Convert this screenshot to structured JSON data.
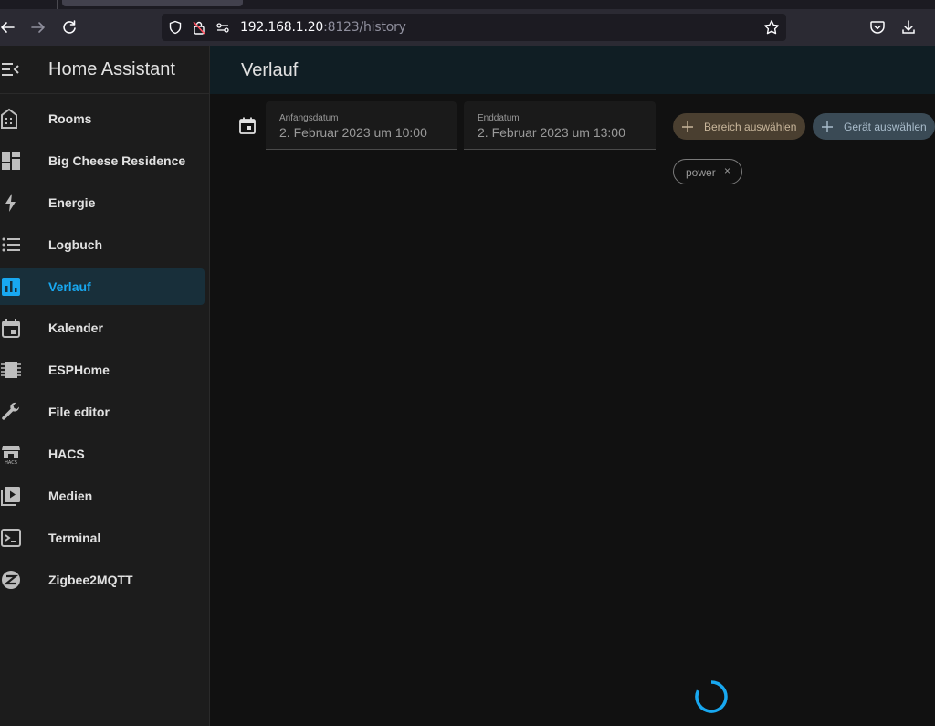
{
  "browser": {
    "url_host": "192.168.1.20",
    "url_rest": ":8123/history",
    "icons": [
      "back-icon",
      "forward-icon",
      "reload-icon",
      "shield-icon",
      "tracking-lock-icon",
      "permissions-icon",
      "bookmark-star-icon",
      "pocket-icon",
      "download-icon"
    ]
  },
  "sidebar": {
    "title": "Home Assistant",
    "items": [
      {
        "label": "Rooms",
        "icon": "building-icon"
      },
      {
        "label": "Big Cheese Residence",
        "icon": "dashboard-icon"
      },
      {
        "label": "Energie",
        "icon": "lightning-icon"
      },
      {
        "label": "Logbuch",
        "icon": "list-icon"
      },
      {
        "label": "Verlauf",
        "icon": "chart-icon",
        "active": true
      },
      {
        "label": "Kalender",
        "icon": "calendar-icon"
      },
      {
        "label": "ESPHome",
        "icon": "chip-icon"
      },
      {
        "label": "File editor",
        "icon": "wrench-icon"
      },
      {
        "label": "HACS",
        "icon": "hacs-icon"
      },
      {
        "label": "Medien",
        "icon": "media-icon"
      },
      {
        "label": "Terminal",
        "icon": "terminal-icon"
      },
      {
        "label": "Zigbee2MQTT",
        "icon": "zigbee-icon"
      }
    ]
  },
  "main": {
    "title": "Verlauf",
    "start": {
      "label": "Anfangsdatum",
      "value": "2. Februar 2023 um 10:00"
    },
    "end": {
      "label": "Enddatum",
      "value": "2. Februar 2023 um 13:00"
    },
    "area_button": "Bereich auswählen",
    "device_button": "Gerät auswählen",
    "chip": "power",
    "chip_close": "×"
  },
  "colors": {
    "accent": "#18a8f0",
    "active_bg": "#182f3a",
    "sidebar_bg": "#1c1c1c",
    "main_bg": "#111111"
  }
}
